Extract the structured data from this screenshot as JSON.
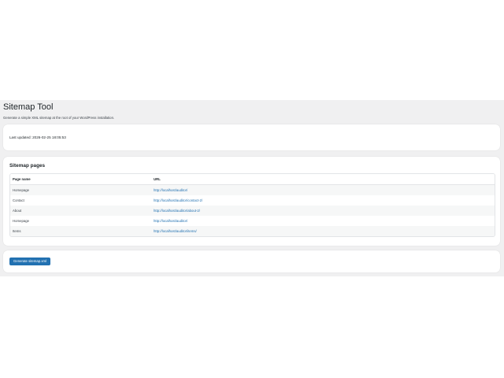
{
  "page": {
    "title": "Sitemap Tool",
    "description": "Generate a simple XML sitemap at the root of your WordPress installation."
  },
  "status": {
    "last_updated_label": "Last updated:",
    "last_updated_value": "2026-02-25 18:05:53"
  },
  "pages_section": {
    "title": "Sitemap pages",
    "columns": [
      "Page name",
      "URL"
    ],
    "rows": [
      {
        "name": "Homepage",
        "url": "http://localhost/auditor/"
      },
      {
        "name": "Contact",
        "url": "http://localhost/auditor/contact-2/"
      },
      {
        "name": "About",
        "url": "http://localhost/auditor/about-2/"
      },
      {
        "name": "Homepage",
        "url": "http://localhost/auditor/"
      },
      {
        "name": "Items",
        "url": "http://localhost/auditor/items/"
      }
    ]
  },
  "actions": {
    "generate_label": "Generate sitemap.xml"
  },
  "colors": {
    "accent": "#2271b1",
    "background": "#f0f0f1",
    "card": "#ffffff"
  }
}
